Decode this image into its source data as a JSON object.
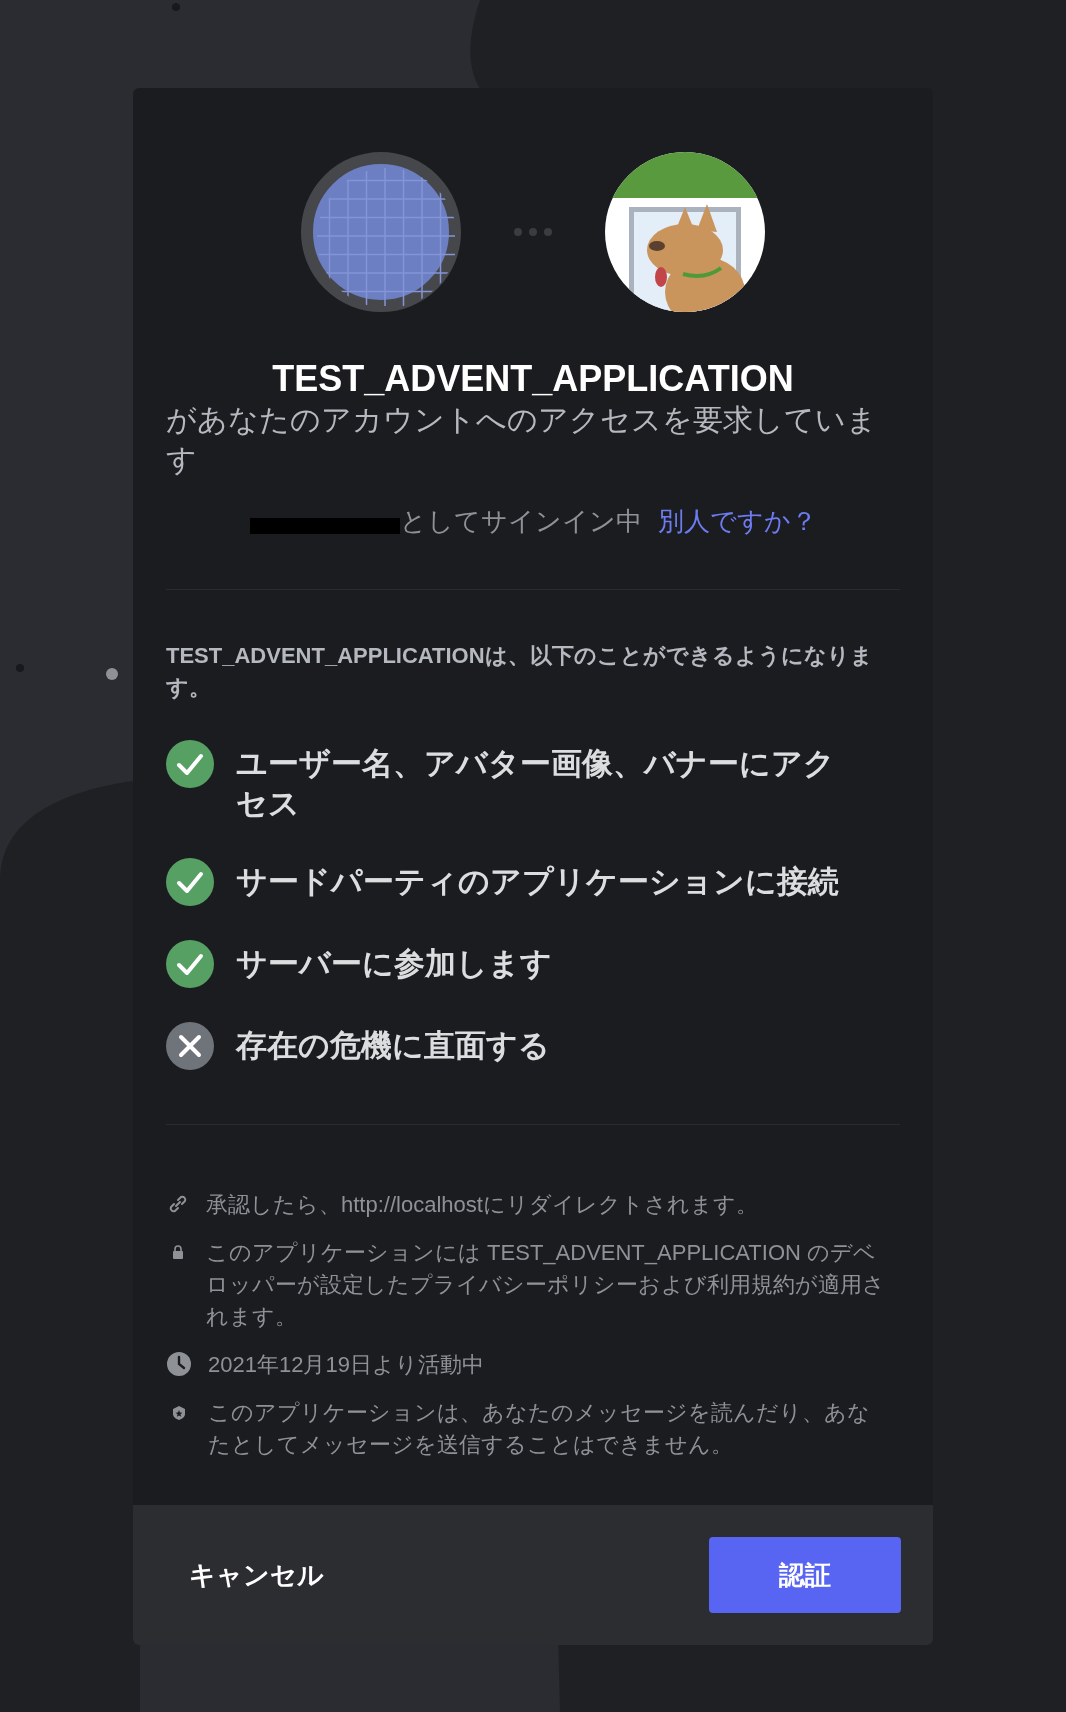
{
  "app_name": "TEST_ADVENT_APPLICATION",
  "request_text": "があなたのアカウントへのアクセスを要求しています",
  "signed_in": {
    "text": "としてサインイン中",
    "link": "別人ですか？"
  },
  "permissions_heading": "TEST_ADVENT_APPLICATIONは、以下のことができるようになります。",
  "permissions": [
    {
      "text": "ユーザー名、アバター画像、バナーにアクセス",
      "granted": true
    },
    {
      "text": "サードパーティのアプリケーションに接続",
      "granted": true
    },
    {
      "text": "サーバーに参加します",
      "granted": true
    },
    {
      "text": "存在の危機に直面する",
      "granted": false
    }
  ],
  "info": [
    {
      "kind": "link",
      "text": "承認したら、http://localhostにリダイレクトされます。"
    },
    {
      "kind": "lock",
      "text": "このアプリケーションには TEST_ADVENT_APPLICATION のデベロッパーが設定したプライバシーポリシーおよび利用規約が適用されます。"
    },
    {
      "kind": "clock",
      "text": "2021年12月19日より活動中"
    },
    {
      "kind": "shield",
      "text": "このアプリケーションは、あなたのメッセージを読んだり、あなたとしてメッセージを送信することはできません。"
    }
  ],
  "buttons": {
    "cancel": "キャンセル",
    "authorize": "認証"
  }
}
